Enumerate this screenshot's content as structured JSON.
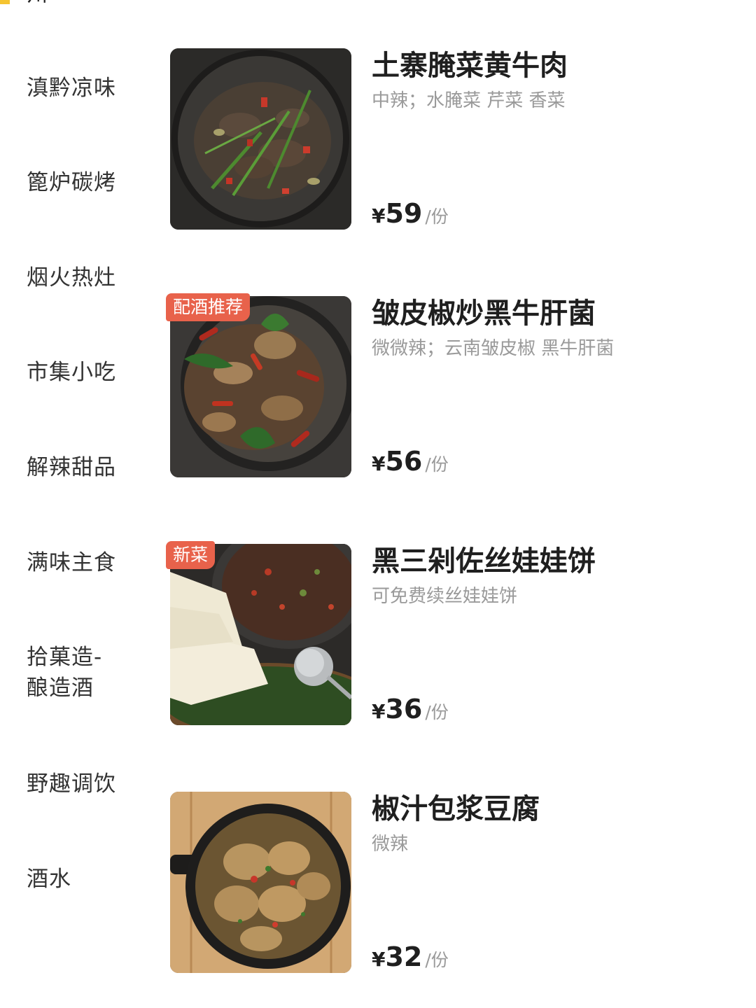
{
  "top_cut_text": "州",
  "colors": {
    "accent": "#f5c431",
    "tag": "#e8624b",
    "muted_text": "#9a9a9a"
  },
  "sidebar": {
    "items": [
      {
        "label": "滇黔凉味"
      },
      {
        "label": "篦炉碳烤"
      },
      {
        "label": "烟火热灶"
      },
      {
        "label": "市集小吃"
      },
      {
        "label": "解辣甜品"
      },
      {
        "label": "满味主食"
      },
      {
        "label": "拾菓造-\n酿造酒"
      },
      {
        "label": "野趣调饮"
      },
      {
        "label": "酒水"
      }
    ]
  },
  "dishes": [
    {
      "name": "土寨腌菜黄牛肉",
      "desc": "中辣；水腌菜 芹菜 香菜",
      "currency": "¥",
      "price": "59",
      "unit": "/份",
      "tag": "",
      "image": "stir-fried-beef-icon"
    },
    {
      "name": "皱皮椒炒黑牛肝菌",
      "desc": "微微辣；云南皱皮椒 黑牛肝菌",
      "currency": "¥",
      "price": "56",
      "unit": "/份",
      "tag": "配酒推荐",
      "image": "mushroom-chili-stirfry-icon"
    },
    {
      "name": "黑三剁佐丝娃娃饼",
      "desc": "可免费续丝娃娃饼",
      "currency": "¥",
      "price": "36",
      "unit": "/份",
      "tag": "新菜",
      "image": "minced-pork-with-pancakes-icon"
    },
    {
      "name": "椒汁包浆豆腐",
      "desc": "微辣",
      "currency": "¥",
      "price": "32",
      "unit": "/份",
      "tag": "",
      "image": "tofu-in-pepper-sauce-icon"
    }
  ]
}
